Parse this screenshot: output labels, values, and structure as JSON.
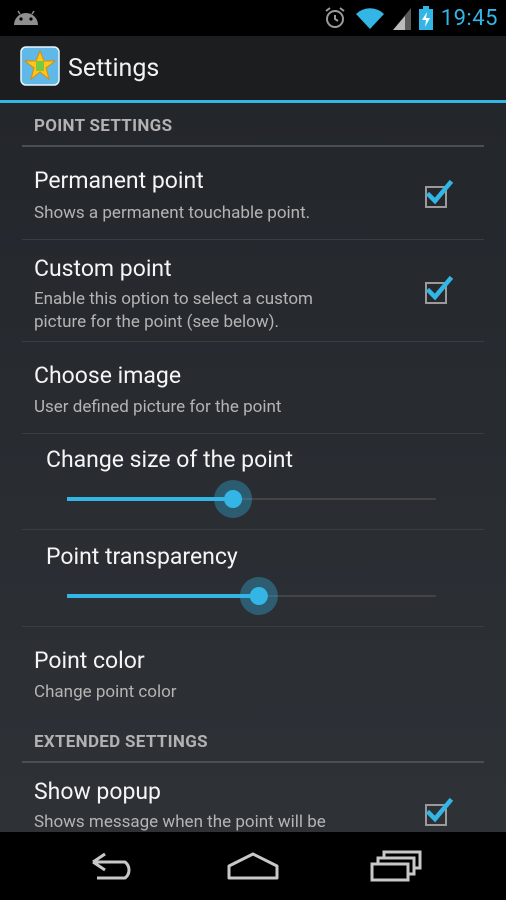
{
  "status_bar": {
    "time": "19:45"
  },
  "action_bar": {
    "title": "Settings"
  },
  "sections": {
    "point": "POINT SETTINGS",
    "extended": "EXTENDED SETTINGS"
  },
  "prefs": {
    "permanent": {
      "title": "Permanent point",
      "summary": "Shows a permanent touchable point.",
      "checked": true
    },
    "custom": {
      "title": "Custom point",
      "summary_line1": "Enable this option to select a custom",
      "summary_line2": "picture for the point (see below).",
      "checked": true
    },
    "choose_image": {
      "title": "Choose image",
      "summary": "User defined picture for the point"
    },
    "size": {
      "title": "Change size of the point",
      "value_fraction": 0.45
    },
    "transparency": {
      "title": "Point transparency",
      "value_fraction": 0.52
    },
    "color": {
      "title": "Point color",
      "summary": "Change point color"
    },
    "popup": {
      "title": "Show popup",
      "summary": "Shows message when the point will be",
      "checked": true
    }
  },
  "colors": {
    "accent": "#33b5e5",
    "background": "#2a2e33"
  },
  "icons": {
    "status_left": "android-icon",
    "alarm": "alarm-icon",
    "wifi": "wifi-icon",
    "signal": "signal-icon",
    "battery": "battery-charging-icon",
    "app": "app-star-icon",
    "back": "back-icon",
    "home": "home-icon",
    "recents": "recents-icon"
  }
}
